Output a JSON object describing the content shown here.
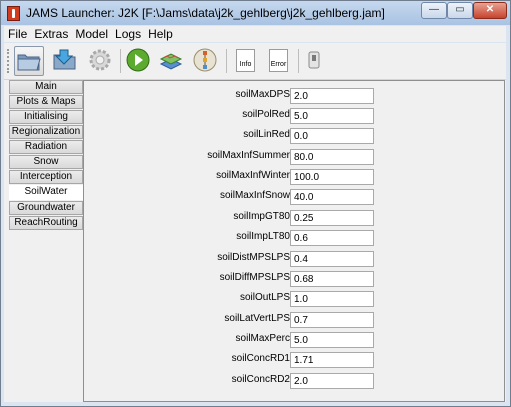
{
  "window": {
    "title": "JAMS Launcher: J2K [F:\\Jams\\data\\j2k_gehlberg\\j2k_gehlberg.jam]"
  },
  "controls": {
    "minimize": "—",
    "maximize": "▭",
    "close": "✕"
  },
  "menu": [
    "File",
    "Extras",
    "Model",
    "Logs",
    "Help"
  ],
  "toolbar": {
    "info_label": "Info",
    "error_label": "Error"
  },
  "tabs": [
    "Main",
    "Plots & Maps",
    "Initialising",
    "Regionalization",
    "Radiation",
    "Snow",
    "Interception",
    "SoilWater",
    "Groundwater",
    "ReachRouting"
  ],
  "active_tab": "SoilWater",
  "params": [
    {
      "label": "soilMaxDPS",
      "value": "2.0"
    },
    {
      "label": "soilPolRed",
      "value": "5.0"
    },
    {
      "label": "soilLinRed",
      "value": "0.0"
    },
    {
      "label": "soilMaxInfSummer",
      "value": "80.0"
    },
    {
      "label": "soilMaxInfWinter",
      "value": "100.0"
    },
    {
      "label": "soilMaxInfSnow",
      "value": "40.0"
    },
    {
      "label": "soilImpGT80",
      "value": "0.25"
    },
    {
      "label": "soilImpLT80",
      "value": "0.6"
    },
    {
      "label": "soilDistMPSLPS",
      "value": "0.4"
    },
    {
      "label": "soilDiffMPSLPS",
      "value": "0.68"
    },
    {
      "label": "soilOutLPS",
      "value": "1.0"
    },
    {
      "label": "soilLatVertLPS",
      "value": "0.7"
    },
    {
      "label": "soilMaxPerc",
      "value": "5.0"
    },
    {
      "label": "soilConcRD1",
      "value": "1.71"
    },
    {
      "label": "soilConcRD2",
      "value": "2.0"
    }
  ]
}
